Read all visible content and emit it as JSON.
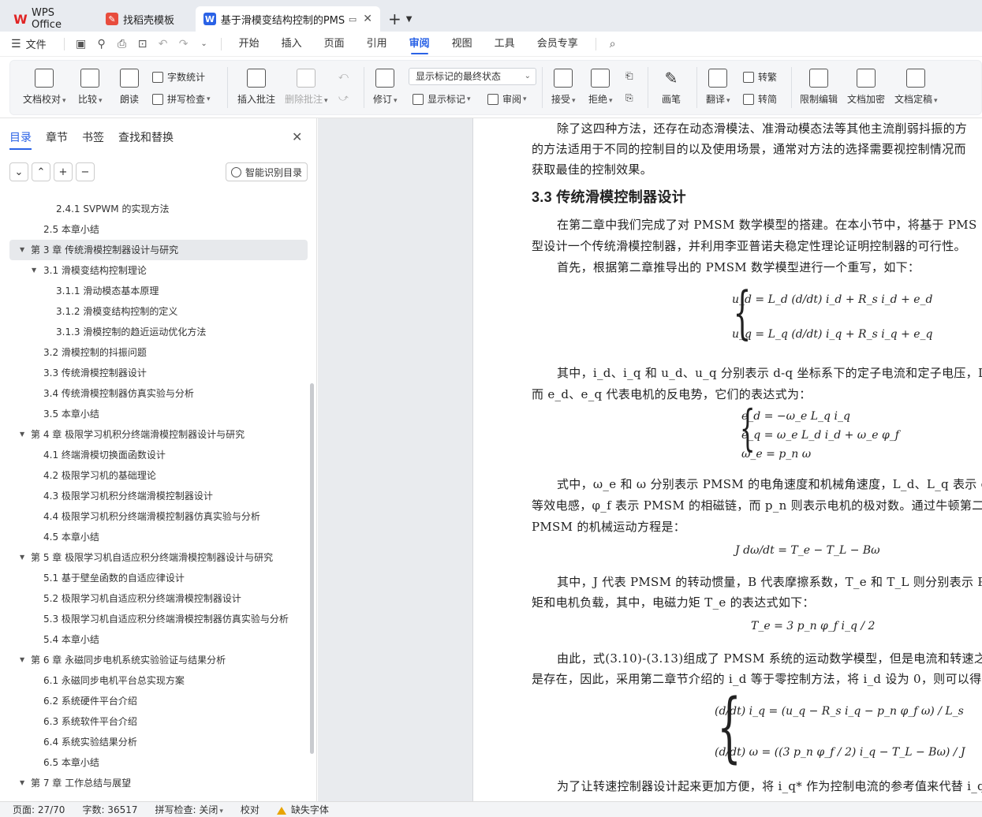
{
  "tabs": {
    "wps": "WPS Office",
    "daoke": "找稻壳模板",
    "doc": "基于滑模变结构控制的PMSM"
  },
  "menu": {
    "file": "文件",
    "items": [
      "开始",
      "插入",
      "页面",
      "引用",
      "审阅",
      "视图",
      "工具",
      "会员专享"
    ]
  },
  "ribbon": {
    "doc_check": "文档校对",
    "compare": "比较",
    "read": "朗读",
    "word_count": "字数统计",
    "spell_check": "拼写检查",
    "insert_comment": "插入批注",
    "delete_comment": "删除批注",
    "revise": "修订",
    "display_state": "显示标记的最终状态",
    "show_marks": "显示标记",
    "review": "审阅",
    "accept": "接受",
    "reject": "拒绝",
    "pen": "画笔",
    "translate": "翻译",
    "to_trad": "转繁",
    "to_simp": "转简",
    "restrict_edit": "限制编辑",
    "doc_encrypt": "文档加密",
    "doc_finalize": "文档定稿"
  },
  "nav": {
    "tabs": [
      "目录",
      "章节",
      "书签",
      "查找和替换"
    ],
    "smart_toc": "智能识别目录"
  },
  "toc": [
    {
      "level": 3,
      "text": "2.4.1 SVPWM 的实现方法"
    },
    {
      "level": 2,
      "text": "2.5  本章小结"
    },
    {
      "level": 1,
      "text": "第 3 章  传统滑模控制器设计与研究",
      "expand": true,
      "selected": true
    },
    {
      "level": 2,
      "text": "3.1  滑模变结构控制理论",
      "expand": true
    },
    {
      "level": 3,
      "text": "3.1.1  滑动模态基本原理"
    },
    {
      "level": 3,
      "text": "3.1.2  滑模变结构控制的定义"
    },
    {
      "level": 3,
      "text": "3.1.3  滑模控制的趋近运动优化方法"
    },
    {
      "level": 2,
      "text": "3.2  滑模控制的抖振问题"
    },
    {
      "level": 2,
      "text": "3.3  传统滑模控制器设计"
    },
    {
      "level": 2,
      "text": "3.4  传统滑模控制器仿真实验与分析"
    },
    {
      "level": 2,
      "text": "3.5  本章小结"
    },
    {
      "level": 1,
      "text": "第 4 章  极限学习机积分终端滑模控制器设计与研究",
      "expand": true
    },
    {
      "level": 2,
      "text": "4.1  终端滑模切换面函数设计"
    },
    {
      "level": 2,
      "text": "4.2  极限学习机的基础理论"
    },
    {
      "level": 2,
      "text": "4.3  极限学习机积分终端滑模控制器设计"
    },
    {
      "level": 2,
      "text": "4.4  极限学习机积分终端滑模控制器仿真实验与分析"
    },
    {
      "level": 2,
      "text": "4.5  本章小结"
    },
    {
      "level": 1,
      "text": "第 5 章  极限学习机自适应积分终端滑模控制器设计与研究",
      "expand": true
    },
    {
      "level": 2,
      "text": "5.1  基于壁垒函数的自适应律设计"
    },
    {
      "level": 2,
      "text": "5.2  极限学习机自适应积分终端滑模控制器设计"
    },
    {
      "level": 2,
      "text": "5.3  极限学习机自适应积分终端滑模控制器仿真实验与分析"
    },
    {
      "level": 2,
      "text": "5.4  本章小结"
    },
    {
      "level": 1,
      "text": "第 6 章  永磁同步电机系统实验验证与结果分析",
      "expand": true
    },
    {
      "level": 2,
      "text": "6.1  永磁同步电机平台总实现方案"
    },
    {
      "level": 2,
      "text": "6.2  系统硬件平台介绍"
    },
    {
      "level": 2,
      "text": "6.3  系统软件平台介绍"
    },
    {
      "level": 2,
      "text": "6.4  系统实验结果分析"
    },
    {
      "level": 2,
      "text": "6.5  本章小结"
    },
    {
      "level": 1,
      "text": "第 7 章  工作总结与展望",
      "expand": true
    }
  ],
  "doc": {
    "p1a": "除了这四种方法，还存在动态滑模法、准滑动模态法等其他主流削弱抖振的方",
    "p1b": "的方法适用于不同的控制目的以及使用场景，通常对方法的选择需要视控制情况而",
    "p1c": "获取最佳的控制效果。",
    "heading": "3.3  传统滑模控制器设计",
    "p2a": "在第二章中我们完成了对 PMSM 数学模型的搭建。在本小节中，将基于 PMS",
    "p2b": "型设计一个传统滑模控制器，并利用李亚普诺夫稳定性理论证明控制器的可行性。",
    "p3": "首先，根据第二章推导出的 PMSM 数学模型进行一个重写，如下：",
    "p4a": "其中，i_d、i_q 和 u_d、u_q 分别表示 d-q 坐标系下的定子电流和定子电压，L 表示",
    "p4b": "而 e_d、e_q 代表电机的反电势，它们的表达式为：",
    "p5a": "式中，ω_e 和 ω 分别表示 PMSM 的电角速度和机械角速度，L_d、L_q 表示 d-q 坐",
    "p5b": "等效电感，φ_f 表示 PMSM 的相磁链，而 p_n 则表示电机的极对数。通过牛顿第二定",
    "p5c": "PMSM 的机械运动方程是：",
    "p6a": "其中，J 代表 PMSM 的转动惯量，B 代表摩擦系数，T_e 和 T_L 则分别表示 PMSM",
    "p6b": "矩和电机负载，其中，电磁力矩 T_e 的表达式如下：",
    "p7a": "由此，式(3.10)-(3.13)组成了 PMSM 系统的运动数学模型，但是电流和转速之间",
    "p7b": "是存在，因此，采用第二章节介绍的 i_d 等于零控制方法，将 i_d 设为 0，则可以得到如",
    "p8": "为了让转速控制器设计起来更加方便，将 i_q* 作为控制电流的参考值来代替 i_q，",
    "eq1a": "u_d = L_d (d/dt) i_d + R_s i_d + e_d",
    "eq1b": "u_q = L_q (d/dt) i_q + R_s i_q + e_q",
    "eq2a": "e_d = −ω_e L_q i_q",
    "eq2b": "e_q = ω_e L_d i_d + ω_e φ_f",
    "eq2c": "ω_e = p_n ω",
    "eq3": "J dω/dt = T_e − T_L − Bω",
    "eq4": "T_e = 3 p_n φ_f i_q / 2",
    "eq5a": "(d/dt) i_q = (u_q − R_s i_q − p_n φ_f ω) / L_s",
    "eq5b": "(d/dt) ω = ((3 p_n φ_f / 2) i_q − T_L − Bω) / J"
  },
  "status": {
    "page": "页面: 27/70",
    "words": "字数: 36517",
    "spell": "拼写检查: 关闭",
    "proof": "校对",
    "missing_font": "缺失字体"
  }
}
